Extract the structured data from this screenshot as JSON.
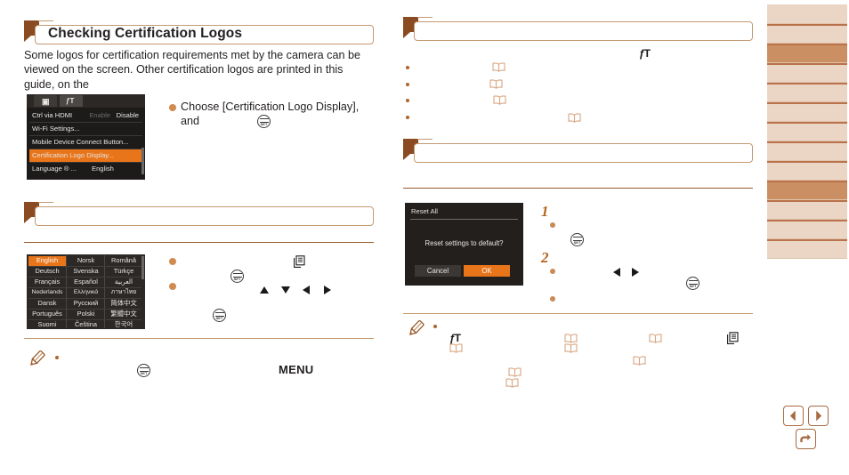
{
  "document": {
    "left_column": {
      "section_header": {
        "title": "Checking Certification Logos",
        "marker": "flag-marker"
      },
      "intro_paragraph": "Some logos for certification requirements met by the camera can be viewed on the screen. Other certification logos are printed in this guide, on the",
      "instruction": "Choose [Certification Logo Display], and",
      "empty_section_header": "",
      "note_label": "MENU",
      "note_icon": "pencil-icon"
    },
    "right_column": {
      "section_header_1": "",
      "section_header_2": "",
      "steps": [
        {
          "number": "1"
        },
        {
          "number": "2"
        }
      ],
      "note_icon": "pencil-icon"
    }
  },
  "camera_menu_screenshot": {
    "tabs": [
      {
        "icon": "camera-icon",
        "glyph": "■",
        "selected": false
      },
      {
        "icon": "setup-wrench-icon",
        "glyph": "ƒT",
        "selected": true
      }
    ],
    "rows": [
      {
        "label": "Ctrl via HDMI",
        "value_dim": "Enable",
        "value": "Disable",
        "highlighted": false
      },
      {
        "label": "Wi-Fi Settings...",
        "value_dim": "",
        "value": "",
        "highlighted": false
      },
      {
        "label": "Mobile Device Connect Button...",
        "value_dim": "",
        "value": "",
        "highlighted": false
      },
      {
        "label": "Certification Logo Display...",
        "value_dim": "",
        "value": "",
        "highlighted": true
      },
      {
        "label": "Language ® ...",
        "value_dim": "",
        "value": "English",
        "highlighted": false
      }
    ]
  },
  "language_screenshot": {
    "selected": "English",
    "rows": [
      [
        "English",
        "Norsk",
        "Română"
      ],
      [
        "Deutsch",
        "Svenska",
        "Türkçe"
      ],
      [
        "Français",
        "Español",
        "العربية"
      ],
      [
        "Nederlands",
        "Ελληνικά",
        "ภาษาไทย"
      ],
      [
        "Dansk",
        "Русский",
        "简体中文"
      ],
      [
        "Português",
        "Polski",
        "繁體中文"
      ],
      [
        "Suomi",
        "Čeština",
        "한국어"
      ]
    ]
  },
  "reset_dialog_screenshot": {
    "title": "Reset All",
    "message": "Reset settings to default?",
    "cancel_label": "Cancel",
    "ok_label": "OK"
  },
  "sidebar": {
    "tabs": [
      {
        "active": false
      },
      {
        "active": false
      },
      {
        "active": true
      },
      {
        "active": false
      },
      {
        "active": false
      },
      {
        "active": false
      },
      {
        "active": false
      },
      {
        "active": false
      },
      {
        "active": false
      },
      {
        "active": true
      },
      {
        "active": false
      },
      {
        "active": false
      },
      {
        "active": false
      }
    ]
  },
  "navigation": {
    "prev_label": "previous-page",
    "next_label": "next-page",
    "back_label": "return-to-top"
  },
  "colors": {
    "accent_brown": "#8a4b22",
    "rule_brown": "#9a5a2a",
    "header_border": "#c49a72",
    "bullet": "#c98a56",
    "step_number": "#b5651d",
    "highlight_orange": "#e8751a",
    "tab_light": "#ebd5c4",
    "tab_active": "#ca8f63"
  }
}
